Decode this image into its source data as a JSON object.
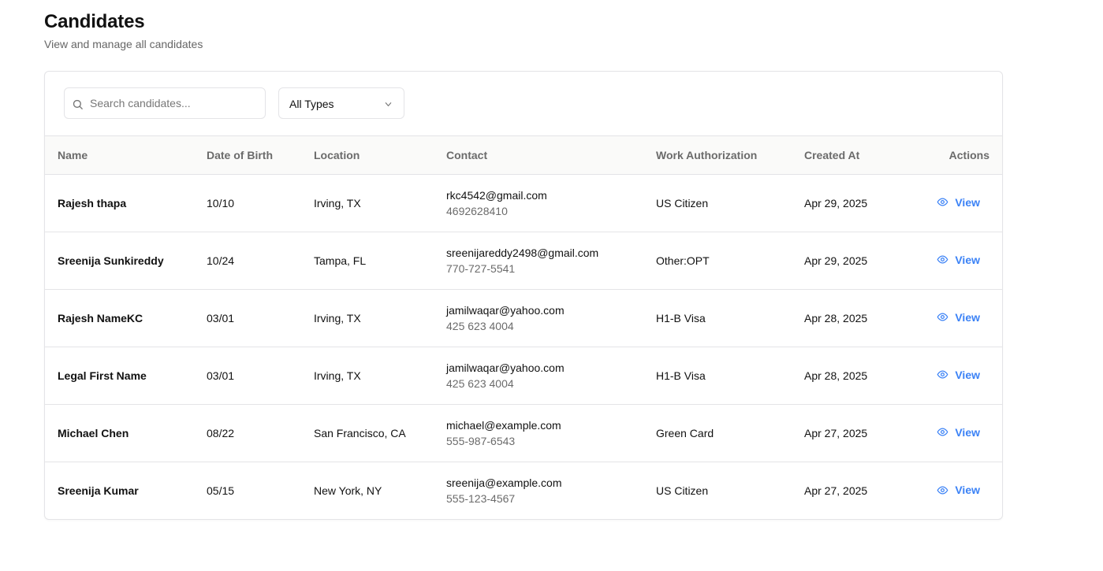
{
  "header": {
    "title": "Candidates",
    "subtitle": "View and manage all candidates"
  },
  "toolbar": {
    "search_placeholder": "Search candidates...",
    "type_filter": "All Types"
  },
  "table": {
    "columns": [
      "Name",
      "Date of Birth",
      "Location",
      "Contact",
      "Work Authorization",
      "Created At",
      "Actions"
    ],
    "rows": [
      {
        "name": "Rajesh thapa",
        "dob": "10/10",
        "location": "Irving, TX",
        "email": "rkc4542@gmail.com",
        "phone": "4692628410",
        "work_auth": "US Citizen",
        "created": "Apr 29, 2025",
        "action": "View"
      },
      {
        "name": "Sreenija Sunkireddy",
        "dob": "10/24",
        "location": "Tampa, FL",
        "email": "sreenijareddy2498@gmail.com",
        "phone": "770-727-5541",
        "work_auth": "Other:OPT",
        "created": "Apr 29, 2025",
        "action": "View"
      },
      {
        "name": "Rajesh NameKC",
        "dob": "03/01",
        "location": "Irving, TX",
        "email": "jamilwaqar@yahoo.com",
        "phone": "425 623 4004",
        "work_auth": "H1-B Visa",
        "created": "Apr 28, 2025",
        "action": "View"
      },
      {
        "name": "Legal First Name",
        "dob": "03/01",
        "location": "Irving, TX",
        "email": "jamilwaqar@yahoo.com",
        "phone": "425 623 4004",
        "work_auth": "H1-B Visa",
        "created": "Apr 28, 2025",
        "action": "View"
      },
      {
        "name": "Michael Chen",
        "dob": "08/22",
        "location": "San Francisco, CA",
        "email": "michael@example.com",
        "phone": "555-987-6543",
        "work_auth": "Green Card",
        "created": "Apr 27, 2025",
        "action": "View"
      },
      {
        "name": "Sreenija Kumar",
        "dob": "05/15",
        "location": "New York, NY",
        "email": "sreenija@example.com",
        "phone": "555-123-4567",
        "work_auth": "US Citizen",
        "created": "Apr 27, 2025",
        "action": "View"
      }
    ]
  },
  "icons": {
    "search": "search-icon",
    "dropdown": "chevron-down-icon",
    "view": "eye-icon"
  },
  "colors": {
    "accent": "#3b82f6",
    "border": "#e4e4e7",
    "muted_text": "#6b6b6b"
  }
}
